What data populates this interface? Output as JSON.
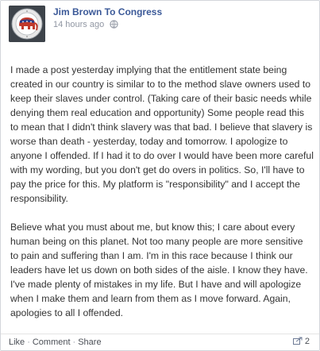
{
  "post": {
    "author": "Jim Brown To Congress",
    "timestamp": "14 hours ago",
    "privacy_icon": "globe-icon",
    "paragraphs": [
      "I made a post yesterday implying that the entitlement state being created in our country is similar to to the method slave owners used to keep their slaves under control. (Taking care of their basic needs while denying them real education and opportunity) Some people read this to mean that I didn't think slavery was that bad. I believe that slavery is worse than death - yesterday, today and tomorrow. I apologize to anyone I offended. If I had it to do over I would have been more careful with my wording, but you don't get do overs in politics. So, I'll have to pay the price for this. My platform is \"responsibility\" and I accept the responsibility.",
      "Believe what you must about me, but know this; I care about every human being on this planet. Not too many people are more sensitive to pain and suffering than I am. I'm in this race because I think our leaders have let us down on both sides of the aisle. I know they have. I've made plenty of mistakes in my life. But I have and will apologize when I make them and learn from them as I move forward. Again, apologies to all I offended."
    ]
  },
  "footer": {
    "like_label": "Like",
    "comment_label": "Comment",
    "share_label": "Share",
    "separator": "·",
    "share_icon": "share-icon",
    "share_count": "2"
  }
}
